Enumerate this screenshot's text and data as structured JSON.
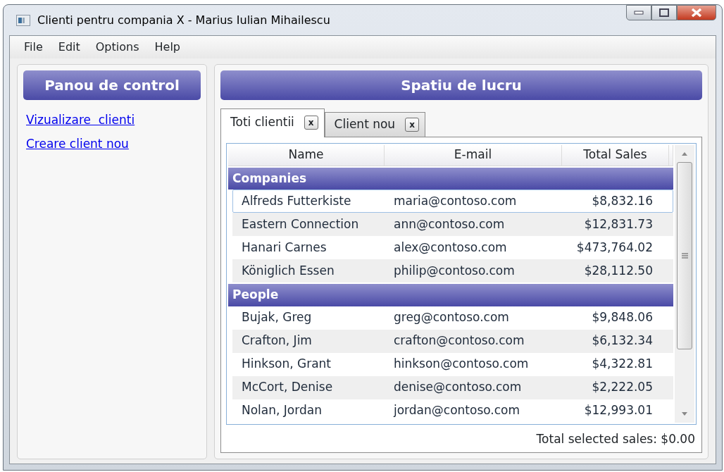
{
  "window": {
    "title": "Clienti pentru compania X - Marius Iulian Mihailescu"
  },
  "menu": [
    "File",
    "Edit",
    "Options",
    "Help"
  ],
  "sidebar": {
    "title": "Panou de control",
    "links": [
      "Vizualizare  clienti",
      "Creare client nou"
    ]
  },
  "workspace": {
    "title": "Spatiu de lucru",
    "tabs": [
      {
        "label": "Toti clientii",
        "close": "x",
        "selected": true
      },
      {
        "label": "Client nou",
        "close": "x",
        "selected": false
      }
    ],
    "table": {
      "columns": [
        "Name",
        "E-mail",
        "Total Sales"
      ],
      "groups": [
        {
          "name": "Companies",
          "rows": [
            {
              "name": "Alfreds Futterkiste",
              "email": "maria@contoso.com",
              "sales": "$8,832.16",
              "focused": true
            },
            {
              "name": "Eastern Connection",
              "email": "ann@contoso.com",
              "sales": "$12,831.73",
              "focused": false
            },
            {
              "name": "Hanari Carnes",
              "email": "alex@contoso.com",
              "sales": "$473,764.02",
              "focused": false
            },
            {
              "name": "Königlich Essen",
              "email": "philip@contoso.com",
              "sales": "$28,112.50",
              "focused": false
            }
          ]
        },
        {
          "name": "People",
          "rows": [
            {
              "name": "Bujak, Greg",
              "email": "greg@contoso.com",
              "sales": "$9,848.06",
              "focused": false
            },
            {
              "name": "Crafton, Jim",
              "email": "crafton@contoso.com",
              "sales": "$6,132.34",
              "focused": false
            },
            {
              "name": "Hinkson, Grant",
              "email": "hinkson@contoso.com",
              "sales": "$4,322.81",
              "focused": false
            },
            {
              "name": "McCort, Denise",
              "email": "denise@contoso.com",
              "sales": "$2,222.05",
              "focused": false
            },
            {
              "name": "Nolan, Jordan",
              "email": "jordan@contoso.com",
              "sales": "$12,993.01",
              "focused": false
            }
          ]
        }
      ]
    },
    "footer": "Total selected sales: $0.00"
  }
}
